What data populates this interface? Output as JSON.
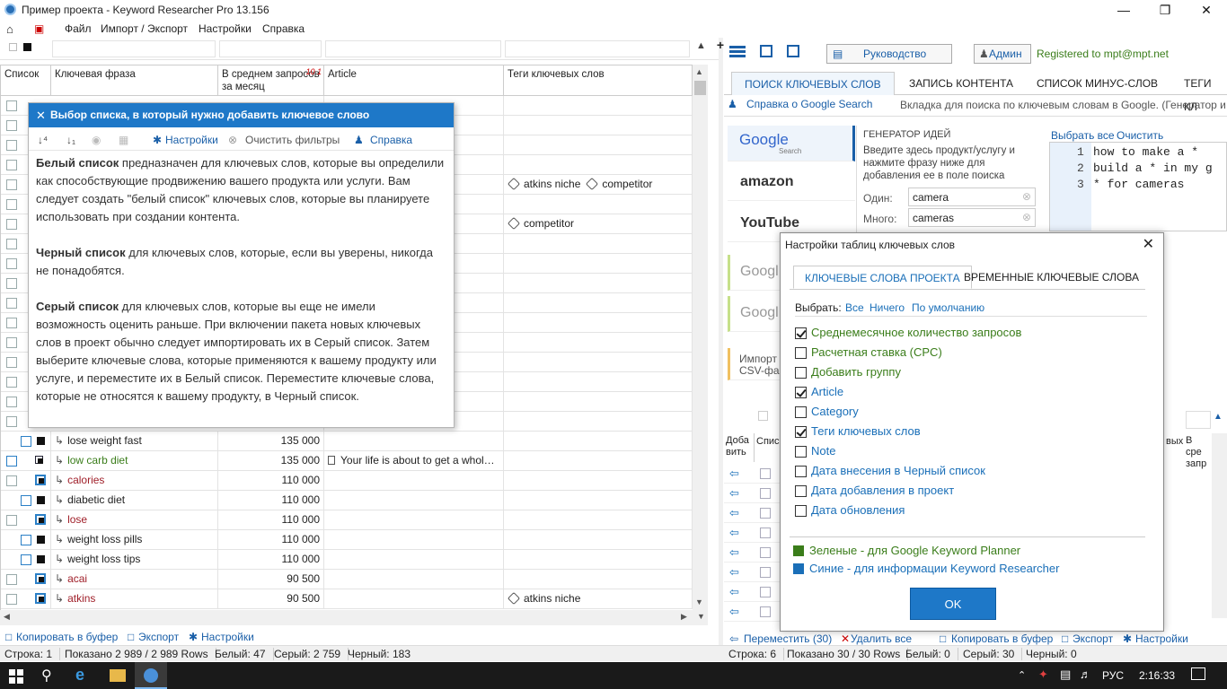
{
  "window": {
    "title": "Пример проекта - Keyword Researcher Pro 13.156"
  },
  "menu": [
    "Файл",
    "Импорт / Экспорт",
    "Настройки",
    "Справка"
  ],
  "grid": {
    "headers": {
      "list": "Список",
      "phrase": "Ключевая фраза",
      "avg": "В среднем запросов за месяц",
      "avg_sort": "10 1",
      "article": "Article",
      "tags": "Теги ключевых слов"
    },
    "top_rows": [
      {
        "tags": [
          "atkins niche",
          "competitor"
        ]
      },
      {
        "tags": [
          "competitor"
        ]
      }
    ],
    "rows": [
      {
        "list": "black",
        "phrase": "lose weight fast",
        "color": "#222",
        "avg": "135 000",
        "article": "",
        "tags": []
      },
      {
        "list": "white",
        "phrase": "low carb diet",
        "color": "#3a7d1a",
        "avg": "135 000",
        "article": "Your life is about to get a whol…",
        "tags": []
      },
      {
        "list": "black-sel",
        "phrase": "calories",
        "color": "#a0202a",
        "avg": "110 000",
        "article": "",
        "tags": []
      },
      {
        "list": "black",
        "phrase": "diabetic diet",
        "color": "#222",
        "avg": "110 000",
        "article": "",
        "tags": []
      },
      {
        "list": "black-sel",
        "phrase": "lose",
        "color": "#a0202a",
        "avg": "110 000",
        "article": "",
        "tags": []
      },
      {
        "list": "black",
        "phrase": "weight loss pills",
        "color": "#222",
        "avg": "110 000",
        "article": "",
        "tags": []
      },
      {
        "list": "black",
        "phrase": "weight loss tips",
        "color": "#222",
        "avg": "110 000",
        "article": "",
        "tags": []
      },
      {
        "list": "black-sel",
        "phrase": "acai",
        "color": "#a0202a",
        "avg": "90 500",
        "article": "",
        "tags": []
      },
      {
        "list": "black-sel",
        "phrase": "atkins",
        "color": "#a0202a",
        "avg": "90 500",
        "article": "",
        "tags": [
          "atkins niche"
        ]
      }
    ]
  },
  "popup": {
    "title": "Выбор списка, в который нужно добавить ключевое слово",
    "toolbar": {
      "settings": "Настройки",
      "clear": "Очистить фильтры",
      "help": "Справка"
    },
    "p1_bold": "Белый список",
    "p1": " предназначен для ключевых слов, которые вы определили как способствующие продвижению вашего продукта или услуги. Вам следует создать \"белый список\" ключевых слов, которые вы планируете использовать при создании контента.",
    "p2_bold": "Черный список",
    "p2": " для ключевых слов, которые, если вы уверены, никогда не понадобятся.",
    "p3_bold": "Серый список",
    "p3": " для ключевых слов, которые вы еще не имели возможность оценить раньше. При включении пакета новых ключевых слов в проект обычно следует импортировать их в Серый список. Затем выберите ключевые слова, которые применяются к вашему продукту или услуге, и переместите их в Белый список. Переместите ключевые слова, которые не относятся к вашему продукту, в Черный список."
  },
  "bottom_left": {
    "copy": "Копировать в буфер",
    "export": "Экспорт",
    "settings": "Настройки"
  },
  "status_left": {
    "row": "Строка: 1",
    "shown": "Показано 2 989 / 2 989 Rows",
    "white": "Белый: 47",
    "gray": "Серый: 2 759",
    "black": "Черный: 183"
  },
  "right": {
    "guide": "Руководство",
    "admin": "Админ",
    "registered": "Registered to mpt@mpt.net",
    "tabs": [
      "ПОИСК КЛЮЧЕВЫХ СЛОВ",
      "ЗАПИСЬ КОНТЕНТА",
      "СПИСОК МИНУС-СЛОВ",
      "ТЕГИ КЛ"
    ],
    "help_link": "Справка о Google Search",
    "info": "Вкладка для поиска по ключевым словам в Google. (Генератор и",
    "engines": {
      "google": "Google",
      "google_sub": "Search",
      "amazon": "amazon",
      "youtube": "YouTube",
      "g2": "Googl",
      "g3": "Googl",
      "import": "Импорт CSV-файл"
    },
    "ideas": {
      "title": "ГЕНЕРАТОР ИДЕЙ",
      "desc": "Введите здесь продукт/услугу и нажмите фразу ниже для добавления ее в поле поиска",
      "one_label": "Один:",
      "one_value": "camera",
      "many_label": "Много:",
      "many_value": "cameras"
    },
    "select_all": "Выбрать все",
    "clear": "Очистить",
    "kw_lines": [
      "how to make a *",
      "build a * in my g",
      "* for cameras"
    ],
    "grid_header": {
      "add": "Доба вить",
      "list": "Списо",
      "kw": "вых",
      "avg": "В сре запр"
    },
    "bottom": {
      "move": "Переместить (30)",
      "delete": "Удалить все",
      "copy": "Копировать в буфер",
      "export": "Экспорт",
      "settings": "Настройки"
    },
    "status": {
      "row": "Строка: 6",
      "shown": "Показано 30 / 30 Rows",
      "white": "Белый: 0",
      "gray": "Серый: 30",
      "black": "Черный: 0"
    }
  },
  "dialog": {
    "title": "Настройки таблиц ключевых слов",
    "tabs": [
      "КЛЮЧЕВЫЕ СЛОВА ПРОЕКТА",
      "ВРЕМЕННЫЕ КЛЮЧЕВЫЕ СЛОВА"
    ],
    "select_label": "Выбрать:",
    "select_all": "Все",
    "select_none": "Ничего",
    "select_default": "По умолчанию",
    "options": [
      {
        "label": "Среднемесячное количество запросов",
        "checked": true,
        "kind": "green"
      },
      {
        "label": "Расчетная ставка (CPC)",
        "checked": false,
        "kind": "green"
      },
      {
        "label": "Добавить группу",
        "checked": false,
        "kind": "green"
      },
      {
        "label": "Article",
        "checked": true,
        "kind": "blue"
      },
      {
        "label": "Category",
        "checked": false,
        "kind": "blue"
      },
      {
        "label": "Теги ключевых слов",
        "checked": true,
        "kind": "blue"
      },
      {
        "label": "Note",
        "checked": false,
        "kind": "blue"
      },
      {
        "label": "Дата внесения в Черный список",
        "checked": false,
        "kind": "blue"
      },
      {
        "label": "Дата добавления в проект",
        "checked": false,
        "kind": "blue"
      },
      {
        "label": "Дата обновления",
        "checked": false,
        "kind": "blue"
      }
    ],
    "legend_green": "Зеленые - для Google Keyword Planner",
    "legend_blue": "Синие - для информации Keyword Researcher",
    "ok": "OK",
    "colors": {
      "green": "#3a7d1a",
      "blue": "#1a6fb8"
    }
  },
  "taskbar": {
    "lang": "РУС",
    "time": "2:16:33"
  }
}
